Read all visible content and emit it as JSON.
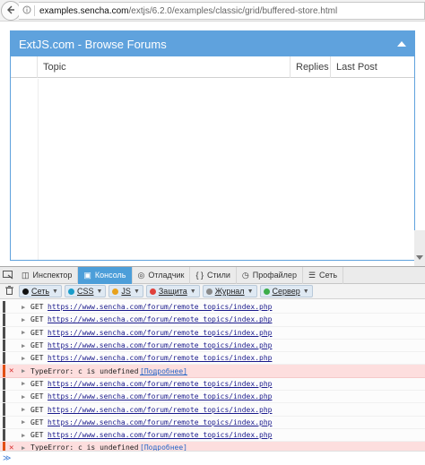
{
  "browser": {
    "url_domain": "examples.sencha.com",
    "url_path": "/extjs/6.2.0/examples/classic/grid/buffered-store.html"
  },
  "panel": {
    "title": "ExtJS.com - Browse Forums",
    "columns": [
      "Topic",
      "Replies",
      "Last Post"
    ]
  },
  "devtools": {
    "tabs": [
      {
        "label": "Инспектор",
        "icon": "inspector-icon",
        "active": false
      },
      {
        "label": "Консоль",
        "icon": "console-icon",
        "active": true
      },
      {
        "label": "Отладчик",
        "icon": "debugger-icon",
        "active": false
      },
      {
        "label": "Стили",
        "icon": "style-editor-icon",
        "active": false
      },
      {
        "label": "Профайлер",
        "icon": "profiler-icon",
        "active": false
      },
      {
        "label": "Сеть",
        "icon": "network-icon",
        "active": false
      }
    ],
    "filters": [
      {
        "label": "Сеть",
        "color": "#111111"
      },
      {
        "label": "CSS",
        "color": "#1a9cc9"
      },
      {
        "label": "JS",
        "color": "#e8a21d"
      },
      {
        "label": "Защита",
        "color": "#e0413b"
      },
      {
        "label": "Журнал",
        "color": "#8a8a8a"
      },
      {
        "label": "Сервер",
        "color": "#3bad4a"
      }
    ],
    "log": [
      {
        "type": "net",
        "method": "GET",
        "url": "https://www.sencha.com/forum/remote_topics/index.php"
      },
      {
        "type": "net",
        "method": "GET",
        "url": "https://www.sencha.com/forum/remote_topics/index.php"
      },
      {
        "type": "net",
        "method": "GET",
        "url": "https://www.sencha.com/forum/remote_topics/index.php"
      },
      {
        "type": "net",
        "method": "GET",
        "url": "https://www.sencha.com/forum/remote_topics/index.php"
      },
      {
        "type": "net",
        "method": "GET",
        "url": "https://www.sencha.com/forum/remote_topics/index.php"
      },
      {
        "type": "error",
        "message": "TypeError: c is undefined",
        "more": "[Подробнее]"
      },
      {
        "type": "net",
        "method": "GET",
        "url": "https://www.sencha.com/forum/remote_topics/index.php"
      },
      {
        "type": "net",
        "method": "GET",
        "url": "https://www.sencha.com/forum/remote_topics/index.php"
      },
      {
        "type": "net",
        "method": "GET",
        "url": "https://www.sencha.com/forum/remote_topics/index.php"
      },
      {
        "type": "net",
        "method": "GET",
        "url": "https://www.sencha.com/forum/remote_topics/index.php"
      },
      {
        "type": "net",
        "method": "GET",
        "url": "https://www.sencha.com/forum/remote_topics/index.php"
      },
      {
        "type": "error",
        "message": "TypeError: c is undefined",
        "more": "[Подробнее]"
      }
    ],
    "prompt": "≫"
  }
}
